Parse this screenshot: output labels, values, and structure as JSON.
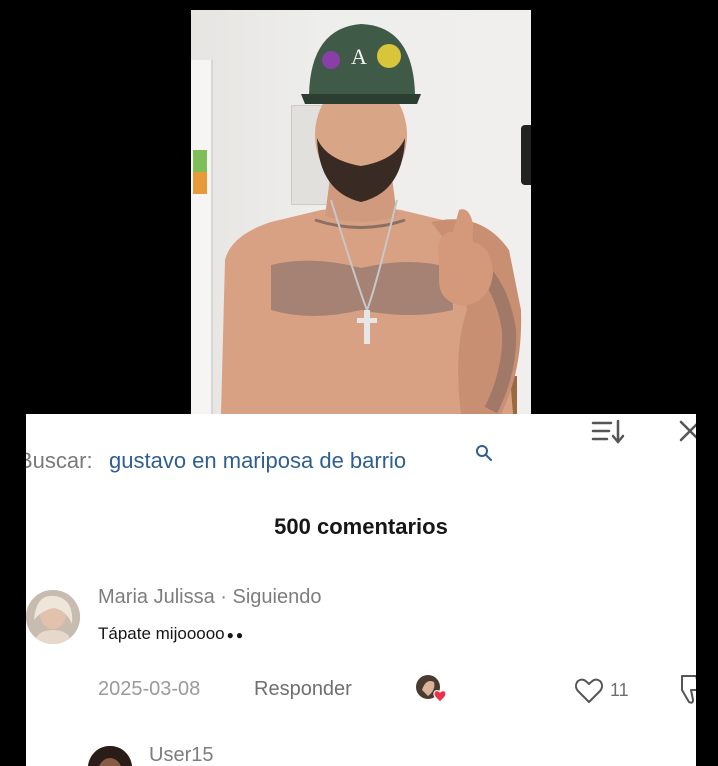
{
  "search": {
    "prefix": "Buscar:",
    "query": "gustavo en mariposa de barrio"
  },
  "icons": {
    "search": "magnifier-icon",
    "sort": "sort-icon",
    "close": "close-icon",
    "like": "heart-outline-icon",
    "dislike": "thumbs-down-icon",
    "creator_like": "avatar-heart-icon"
  },
  "comments_header": {
    "count_label": "500 comentarios"
  },
  "comments": [
    {
      "author": "Maria Julissa",
      "relation": "Siguiendo",
      "meta": "Maria Julissa · Siguiendo",
      "text": "Tápate mijooooo",
      "date": "2025-03-08",
      "reply_label": "Responder",
      "likes": "11"
    },
    {
      "author": "User15"
    }
  ],
  "colors": {
    "accent_link": "#2f5f91",
    "heart": "#e8334a",
    "sheet_bg": "#ffffff"
  }
}
